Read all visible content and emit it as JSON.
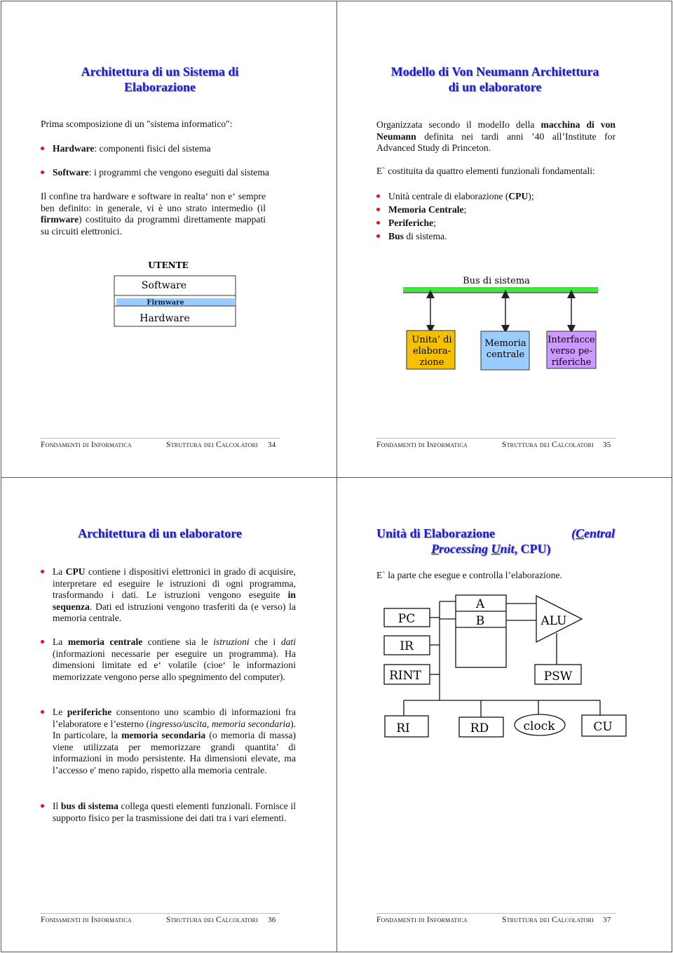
{
  "footer": {
    "course": "Fondamenti di Informatica",
    "section": "Struttura dei Calcolatori"
  },
  "slide34": {
    "page": "34",
    "title": [
      "Architettura di un Sistema di",
      "Elaborazione"
    ],
    "intro": "Prima scomposizione di un \"sistema informatico\":",
    "bullets": [
      [
        {
          "t": "Hardware",
          "b": true
        },
        {
          "t": ":  componenti fisici del sistema"
        }
      ],
      [
        {
          "t": "Software",
          "b": true
        },
        {
          "t": ": i programmi che vengono eseguiti dal sistema"
        }
      ]
    ],
    "paragraph": [
      {
        "t": "Il confine tra hardware e software in realta‘ non e‘ sempre ben definito: in generale, vi è uno strato intermedio (il "
      },
      {
        "t": "firmware",
        "b": true
      },
      {
        "t": ") costituito da programmi direttamente mappati su circuiti elettronici."
      }
    ],
    "diagram": {
      "top": "UTENTE",
      "layers": [
        "Software",
        "Firmware",
        "Hardware"
      ],
      "firmware_color": "#99ccff"
    }
  },
  "slide35": {
    "page": "35",
    "title": [
      "Modello di Von Neumann Architettura",
      "di un elaboratore"
    ],
    "paragraphs": [
      [
        {
          "t": "Organizzata secondo il modelIo della "
        },
        {
          "t": "macchina di von Neumann",
          "b": true
        },
        {
          "t": " definita nei tardi anni ’40 all’Institute for Advanced Study di Princeton."
        }
      ],
      [
        {
          "t": "E` costituita da quattro elementi funzionali fondamentali:"
        }
      ]
    ],
    "bullets": [
      [
        {
          "t": "Unità centrale di elaborazione ("
        },
        {
          "t": "CPU",
          "b": true
        },
        {
          "t": ");"
        }
      ],
      [
        {
          "t": "Memoria Centrale",
          "b": true
        },
        {
          "t": ";"
        }
      ],
      [
        {
          "t": "Periferiche",
          "b": true
        },
        {
          "t": ";"
        }
      ],
      [
        {
          "t": "Bus",
          "b": true
        },
        {
          "t": " di sistema."
        }
      ]
    ],
    "diagram": {
      "bus_label": "Bus di sistema",
      "bus_color": "#33ee33",
      "blocks": [
        {
          "lines": [
            "Unita’ di",
            "elabora-",
            "zione"
          ],
          "color": "#f5c000"
        },
        {
          "lines": [
            "Memoria",
            "centrale"
          ],
          "color": "#99ccff"
        },
        {
          "lines": [
            "Interfacce",
            "verso pe-",
            "riferiche"
          ],
          "color": "#cc99ff"
        }
      ]
    }
  },
  "slide36": {
    "page": "36",
    "title": [
      "Architettura di un elaboratore"
    ],
    "bullets": [
      [
        {
          "t": "La "
        },
        {
          "t": "CPU",
          "b": true
        },
        {
          "t": " contiene i dispositivi elettronici in grado di acquisire, interpretare ed eseguire le istruzioni di ogni programma, trasformando i dati. Le istruzioni vengono eseguite "
        },
        {
          "t": "in sequenza",
          "b": true
        },
        {
          "t": ". Dati ed istruzioni vengono trasferiti da (e verso) la memoria centrale."
        }
      ],
      [
        {
          "t": "La  "
        },
        {
          "t": "memoria centrale",
          "b": true
        },
        {
          "t": " contiene sia le "
        },
        {
          "t": "istruzioni",
          "i": true
        },
        {
          "t": "  che i "
        },
        {
          "t": "dati",
          "i": true
        },
        {
          "t": " (informazioni necessarie per eseguire un programma). Ha dimensioni limitate ed e‘ volatile (cioe‘ le informazioni memorizzate vengono perse allo spegnimento del computer)."
        }
      ],
      [
        {
          "t": "Le "
        },
        {
          "t": "periferiche",
          "b": true
        },
        {
          "t": " consentono uno scambio di informazioni fra l’elaboratore e l’esterno ("
        },
        {
          "t": "ingresso/uscita, memoria secondaria",
          "i": true
        },
        {
          "t": "). In particolare, la "
        },
        {
          "t": "memoria secondaria",
          "b": true
        },
        {
          "t": " (o memoria di massa) viene utilizzata per memorizzare grandi quantita’ di informazioni in modo persistente. Ha dimensioni elevate, ma l’accesso e' meno rapido, rispetto alla memoria centrale."
        }
      ],
      [
        {
          "t": "Il "
        },
        {
          "t": "bus di sistema",
          "b": true
        },
        {
          "t": " collega questi elementi funzionali. Fornisce il supporto fisico per la trasmissione dei dati tra i vari elementi."
        }
      ]
    ]
  },
  "slide37": {
    "page": "37",
    "title_line1": "Unità di Elaborazione",
    "title_paren": "(Central",
    "title_line2": "Processing Unit, CPU)",
    "text": "E` la parte che esegue e controlla l’elaborazione.",
    "diagram": {
      "registers": [
        "PC",
        "IR",
        "RINT"
      ],
      "reg_file": [
        "A",
        "B"
      ],
      "alu": "ALU",
      "psw": "PSW",
      "bottom": [
        "RI",
        "RD",
        "clock",
        "CU"
      ]
    }
  }
}
